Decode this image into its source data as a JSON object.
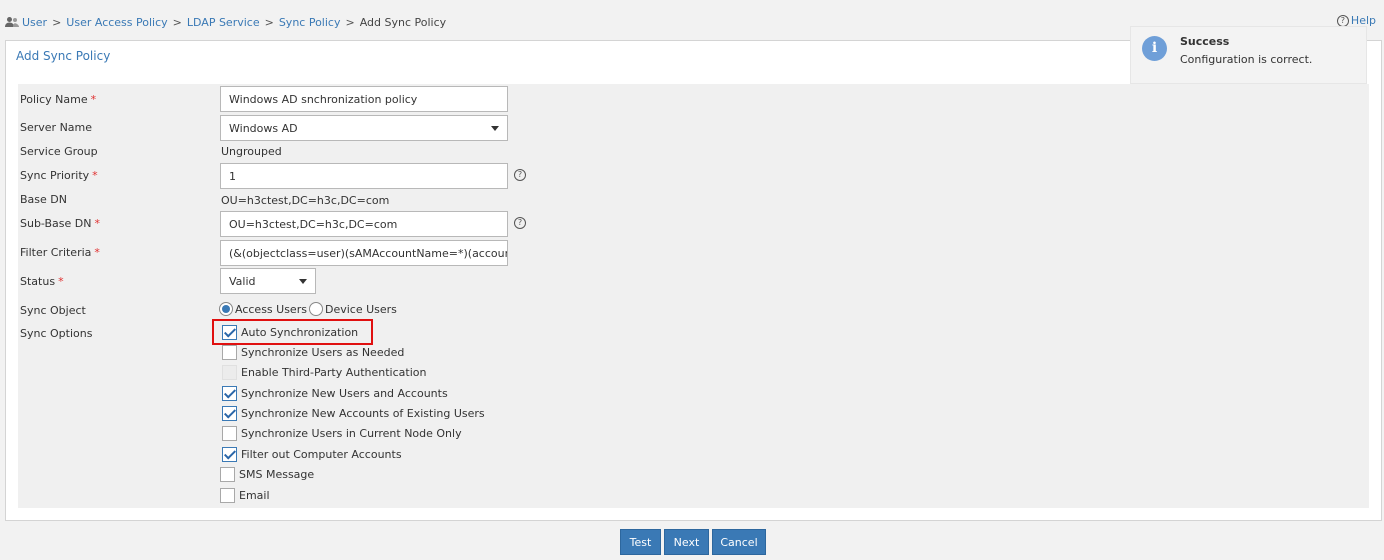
{
  "breadcrumb": {
    "items": [
      "User",
      "User Access Policy",
      "LDAP Service",
      "Sync Policy"
    ],
    "separator": ">",
    "current": "Add Sync Policy"
  },
  "help": {
    "label": "Help"
  },
  "panel": {
    "title": "Add Sync Policy"
  },
  "notification": {
    "title": "Success",
    "message": "Configuration is correct.",
    "icon": "info-icon"
  },
  "form": {
    "required_mark": "*",
    "policy_name": {
      "label": "Policy Name",
      "value": "Windows AD snchronization policy"
    },
    "server_name": {
      "label": "Server Name",
      "value": "Windows AD"
    },
    "service_group": {
      "label": "Service Group",
      "value": "Ungrouped"
    },
    "sync_priority": {
      "label": "Sync Priority",
      "value": "1"
    },
    "base_dn": {
      "label": "Base DN",
      "value": "OU=h3ctest,DC=h3c,DC=com"
    },
    "sub_base_dn": {
      "label": "Sub-Base DN",
      "value": "OU=h3ctest,DC=h3c,DC=com"
    },
    "filter_criteria": {
      "label": "Filter Criteria",
      "value": "(&(objectclass=user)(sAMAccountName=*)(accountEx"
    },
    "status": {
      "label": "Status",
      "value": "Valid"
    },
    "sync_object": {
      "label": "Sync Object",
      "options": [
        {
          "label": "Access Users",
          "selected": true
        },
        {
          "label": "Device Users",
          "selected": false
        }
      ]
    },
    "sync_options": {
      "label": "Sync Options",
      "items": [
        {
          "label": "Auto Synchronization",
          "checked": true,
          "disabled": false
        },
        {
          "label": "Synchronize Users as Needed",
          "checked": false,
          "disabled": false
        },
        {
          "label": "Enable Third-Party Authentication",
          "checked": false,
          "disabled": true
        },
        {
          "label": "Synchronize New Users and Accounts",
          "checked": true,
          "disabled": false
        },
        {
          "label": "Synchronize New Accounts of Existing Users",
          "checked": true,
          "disabled": false
        },
        {
          "label": "Synchronize Users in Current Node Only",
          "checked": false,
          "disabled": false
        },
        {
          "label": "Filter out Computer Accounts",
          "checked": true,
          "disabled": false
        },
        {
          "label": "SMS Message",
          "checked": false,
          "disabled": false
        },
        {
          "label": "Email",
          "checked": false,
          "disabled": false
        }
      ]
    }
  },
  "buttons": {
    "test": "Test",
    "next": "Next",
    "cancel": "Cancel"
  },
  "colors": {
    "accent": "#3a79b5",
    "required": "#e03030",
    "highlight": "#e01010"
  }
}
